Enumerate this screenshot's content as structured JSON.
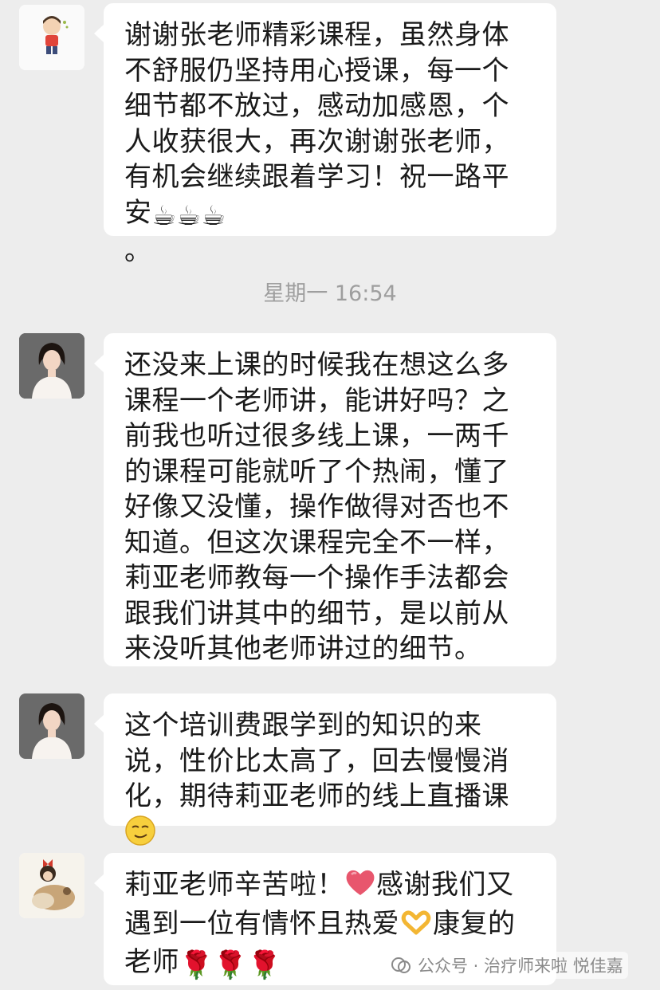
{
  "messages": [
    {
      "text": "谢谢张老师精彩课程，虽然身体不舒服仍坚持用心授课，每一个细节都不放过，感动加感恩，个人收获很大，再次谢谢张老师，有机会继续跟着学习！祝一路平安",
      "emoji": [
        "coffee-icon",
        "coffee-icon",
        "coffee-icon"
      ],
      "tail": "。"
    },
    {
      "text": "还没来上课的时候我在想这么多课程一个老师讲，能讲好吗？之前我也听过很多线上课，一两千的课程可能就听了个热闹，懂了好像又没懂，操作做得对否也不知道。但这次课程完全不一样，莉亚老师教每一个操作手法都会跟我们讲其中的细节，是以前从来没听其他老师讲过的细节。"
    },
    {
      "text": "这个培训费跟学到的知识的来说，性价比太高了，回去慢慢消化，期待莉亚老师的线上直播课"
    },
    {
      "text_a": "莉亚老师辛苦啦！",
      "text_b": "感谢我们又遇到一位有情怀且热爱",
      "text_c": "康复的老师"
    }
  ],
  "timestamp": "星期一 16:54",
  "watermark": "公众号 · 治疗师来啦 悦佳嘉",
  "colors": {
    "background": "#ededed",
    "bubble": "#ffffff",
    "timestamp": "#9e9e9e"
  }
}
